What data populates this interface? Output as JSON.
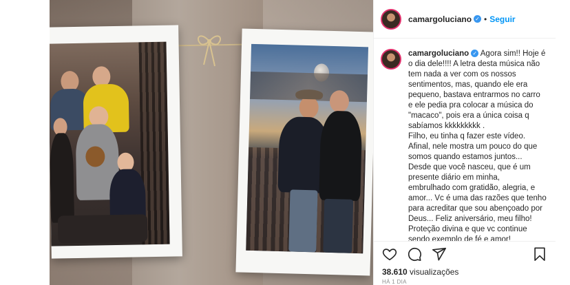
{
  "post": {
    "username": "camargoluciano",
    "follow_label": "Seguir",
    "separator": "•",
    "verified_mark": "✓"
  },
  "caption": {
    "username": "camargoluciano",
    "lines": [
      "Agora sim!! Hoje é",
      "o dia dele!!!! A letra desta música não",
      "tem nada a ver com os nossos",
      "sentimentos, mas, quando ele era",
      "pequeno, bastava entrarmos no carro",
      "e ele pedia pra colocar a música do",
      "\"macaco\", pois era a única coisa q",
      "sabíamos kkkkkkkkk .",
      "Filho, eu tinha q fazer este vídeo.",
      "Afinal, nele mostra um pouco do que",
      "somos quando estamos juntos...",
      "Desde que você nasceu, que é um",
      "presente diário em minha,",
      "embrulhado com gratidão, alegria, e",
      "amor... Vc é uma das razões que tenho",
      "para acreditar que sou abençoado por",
      "Deus... Feliz aniversário, meu filho!",
      "Proteção divina e que vc continue",
      "sendo exemplo de fé e amor!"
    ]
  },
  "stats": {
    "views_count": "38.610",
    "views_label": "visualizações",
    "time_ago": "HÁ 1 DIA"
  },
  "icons": {
    "like": "heart-icon",
    "comment": "comment-icon",
    "share": "share-icon",
    "save": "bookmark-icon"
  },
  "colors": {
    "follow": "#0095f6",
    "verified": "#3897f0",
    "text": "#262626",
    "muted": "#8e8e8e"
  }
}
